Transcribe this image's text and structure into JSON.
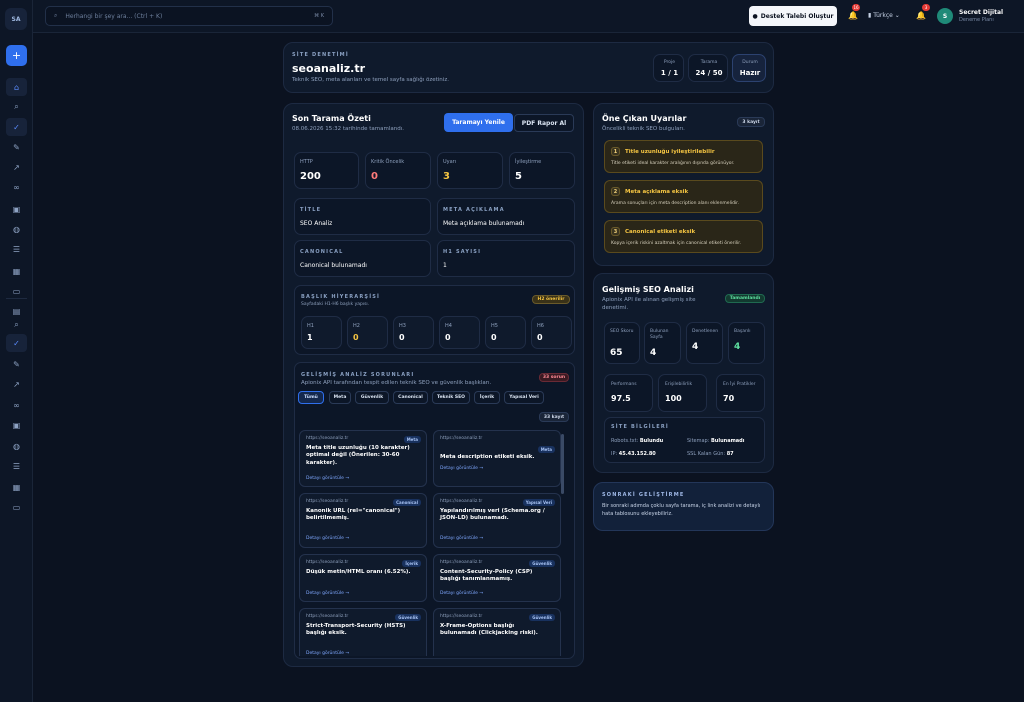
{
  "sidebar": {
    "logo": "SA",
    "add_label": "+"
  },
  "topbar": {
    "search_placeholder": "Herhangi bir şey ara... (Ctrl + K)",
    "search_shortcut": "⌘ K",
    "support_label": "Destek Talebi Oluştur",
    "notif_badge_1": "16",
    "notif_badge_2": "3",
    "language": "Türkçe",
    "user_initial": "S",
    "user_name": "Secret Dijital",
    "user_role": "Deneme Planı"
  },
  "header": {
    "eyebrow": "SİTE DENETİMİ",
    "title": "seoanaliz.tr",
    "subtitle": "Teknik SEO, meta alanları ve temel sayfa sağlığı özetiniz.",
    "stats": [
      {
        "label": "Proje",
        "value": "1 / 1"
      },
      {
        "label": "Tarama",
        "value": "24 / 50"
      },
      {
        "label": "Durum",
        "value": "Hazır"
      }
    ]
  },
  "scan": {
    "title": "Son Tarama Özeti",
    "subtitle": "08.06.2026 15:32 tarihinde tamamlandı.",
    "refresh_label": "Taramayı Yenile",
    "pdf_label": "PDF Rapor Al",
    "metrics": [
      {
        "label": "HTTP",
        "value": "200",
        "color": "#ffffff"
      },
      {
        "label": "Kritik Öncelik",
        "value": "0",
        "color": "#ff7b7b"
      },
      {
        "label": "Uyarı",
        "value": "3",
        "color": "#f5c542"
      },
      {
        "label": "İyileştirme",
        "value": "5",
        "color": "#ffffff"
      }
    ],
    "title_box": {
      "label": "TİTLE",
      "value": "SEO Analiz"
    },
    "meta_box": {
      "label": "META AÇIKLAMA",
      "value": "Meta açıklama bulunamadı"
    },
    "canonical_box": {
      "label": "CANONICAL",
      "value": "Canonical bulunamadı"
    },
    "h1_box": {
      "label": "H1 SAYISI",
      "value": "1"
    }
  },
  "headings": {
    "title": "BAŞLIK HİYERARŞİSİ",
    "subtitle": "Sayfadaki H1-H6 başlık yapısı.",
    "badge": "H2 önerilir",
    "items": [
      {
        "label": "H1",
        "value": "1",
        "color": "#ffffff"
      },
      {
        "label": "H2",
        "value": "0",
        "color": "#f5c542"
      },
      {
        "label": "H3",
        "value": "0",
        "color": "#ffffff"
      },
      {
        "label": "H4",
        "value": "0",
        "color": "#ffffff"
      },
      {
        "label": "H5",
        "value": "0",
        "color": "#ffffff"
      },
      {
        "label": "H6",
        "value": "0",
        "color": "#ffffff"
      }
    ]
  },
  "issues": {
    "title": "GELİŞMİŞ ANALİZ SORUNLARI",
    "subtitle": "Apionix API tarafından tespit edilen teknik SEO ve güvenlik başlıkları.",
    "badge": "33 sorun",
    "count_label": "33 kayıt",
    "tabs": [
      "Tümü",
      "Meta",
      "Güvenlik",
      "Canonical",
      "Teknik SEO",
      "İçerik",
      "Yapısal Veri"
    ],
    "more_label": "Detayı görüntüle →",
    "items": [
      {
        "url": "https://seoanaliz.tr",
        "tag": "Meta",
        "title": "Meta title uzunluğu (10 karakter) optimal değil (Önerilen: 30-60 karakter)."
      },
      {
        "url": "https://seoanaliz.tr",
        "tag": "Meta",
        "title": "Meta description etiketi eksik."
      },
      {
        "url": "https://seoanaliz.tr",
        "tag": "Canonical",
        "title": "Kanonik URL (rel=\"canonical\") belirtilmemiş."
      },
      {
        "url": "https://seoanaliz.tr",
        "tag": "Yapısal Veri",
        "title": "Yapılandırılmış veri (Schema.org / JSON-LD) bulunamadı."
      },
      {
        "url": "https://seoanaliz.tr",
        "tag": "İçerik",
        "title": "Düşük metin/HTML oranı (6.52%)."
      },
      {
        "url": "https://seoanaliz.tr",
        "tag": "Güvenlik",
        "title": "Content-Security-Policy (CSP) başlığı tanımlanmamış."
      },
      {
        "url": "https://seoanaliz.tr",
        "tag": "Güvenlik",
        "title": "Strict-Transport-Security (HSTS) başlığı eksik."
      },
      {
        "url": "https://seoanaliz.tr",
        "tag": "Güvenlik",
        "title": "X-Frame-Options başlığı bulunamadı (Clickjacking riski)."
      }
    ]
  },
  "alerts": {
    "title": "Öne Çıkan Uyarılar",
    "subtitle": "Öncelikli teknik SEO bulguları.",
    "badge": "3 kayıt",
    "items": [
      {
        "num": "1",
        "title": "Title uzunluğu iyileştirilebilir",
        "desc": "Title etiketi ideal karakter aralığının dışında görünüyor."
      },
      {
        "num": "2",
        "title": "Meta açıklama eksik",
        "desc": "Arama sonuçları için meta description alanı eklenmelidir."
      },
      {
        "num": "3",
        "title": "Canonical etiketi eksik",
        "desc": "Kopya içerik riskini azaltmak için canonical etiketi önerilir."
      }
    ]
  },
  "advanced": {
    "title": "Gelişmiş SEO Analizi",
    "subtitle": "Apionix API ile alınan gelişmiş site denetimi.",
    "status": "Tamamlandı",
    "stats": [
      {
        "label": "SEO Skoru",
        "value": "65",
        "color": "#ffffff"
      },
      {
        "label": "Bulunan Sayfa",
        "value": "4",
        "color": "#ffffff"
      },
      {
        "label": "Denetlenen",
        "value": "4",
        "color": "#ffffff"
      },
      {
        "label": "Başarılı",
        "value": "4",
        "color": "#5ee0a0"
      }
    ],
    "perf": [
      {
        "label": "Performans",
        "value": "97.5"
      },
      {
        "label": "Erişilebilirlik",
        "value": "100"
      },
      {
        "label": "En İyi Pratikler",
        "value": "70"
      }
    ],
    "site_info_title": "SİTE BİLGİLERİ",
    "robots_label": "Robots.txt:",
    "robots_value": "Bulundu",
    "sitemap_label": "Sitemap:",
    "sitemap_value": "Bulunamadı",
    "ip_label": "IP:",
    "ip_value": "45.43.152.80",
    "ssl_label": "SSL Kalan Gün:",
    "ssl_value": "87"
  },
  "next": {
    "title": "SONRAKİ GELİŞTİRME",
    "desc": "Bir sonraki adımda çoklu sayfa tarama, iç link analizi ve detaylı hata tablosunu ekleyebiliriz."
  }
}
